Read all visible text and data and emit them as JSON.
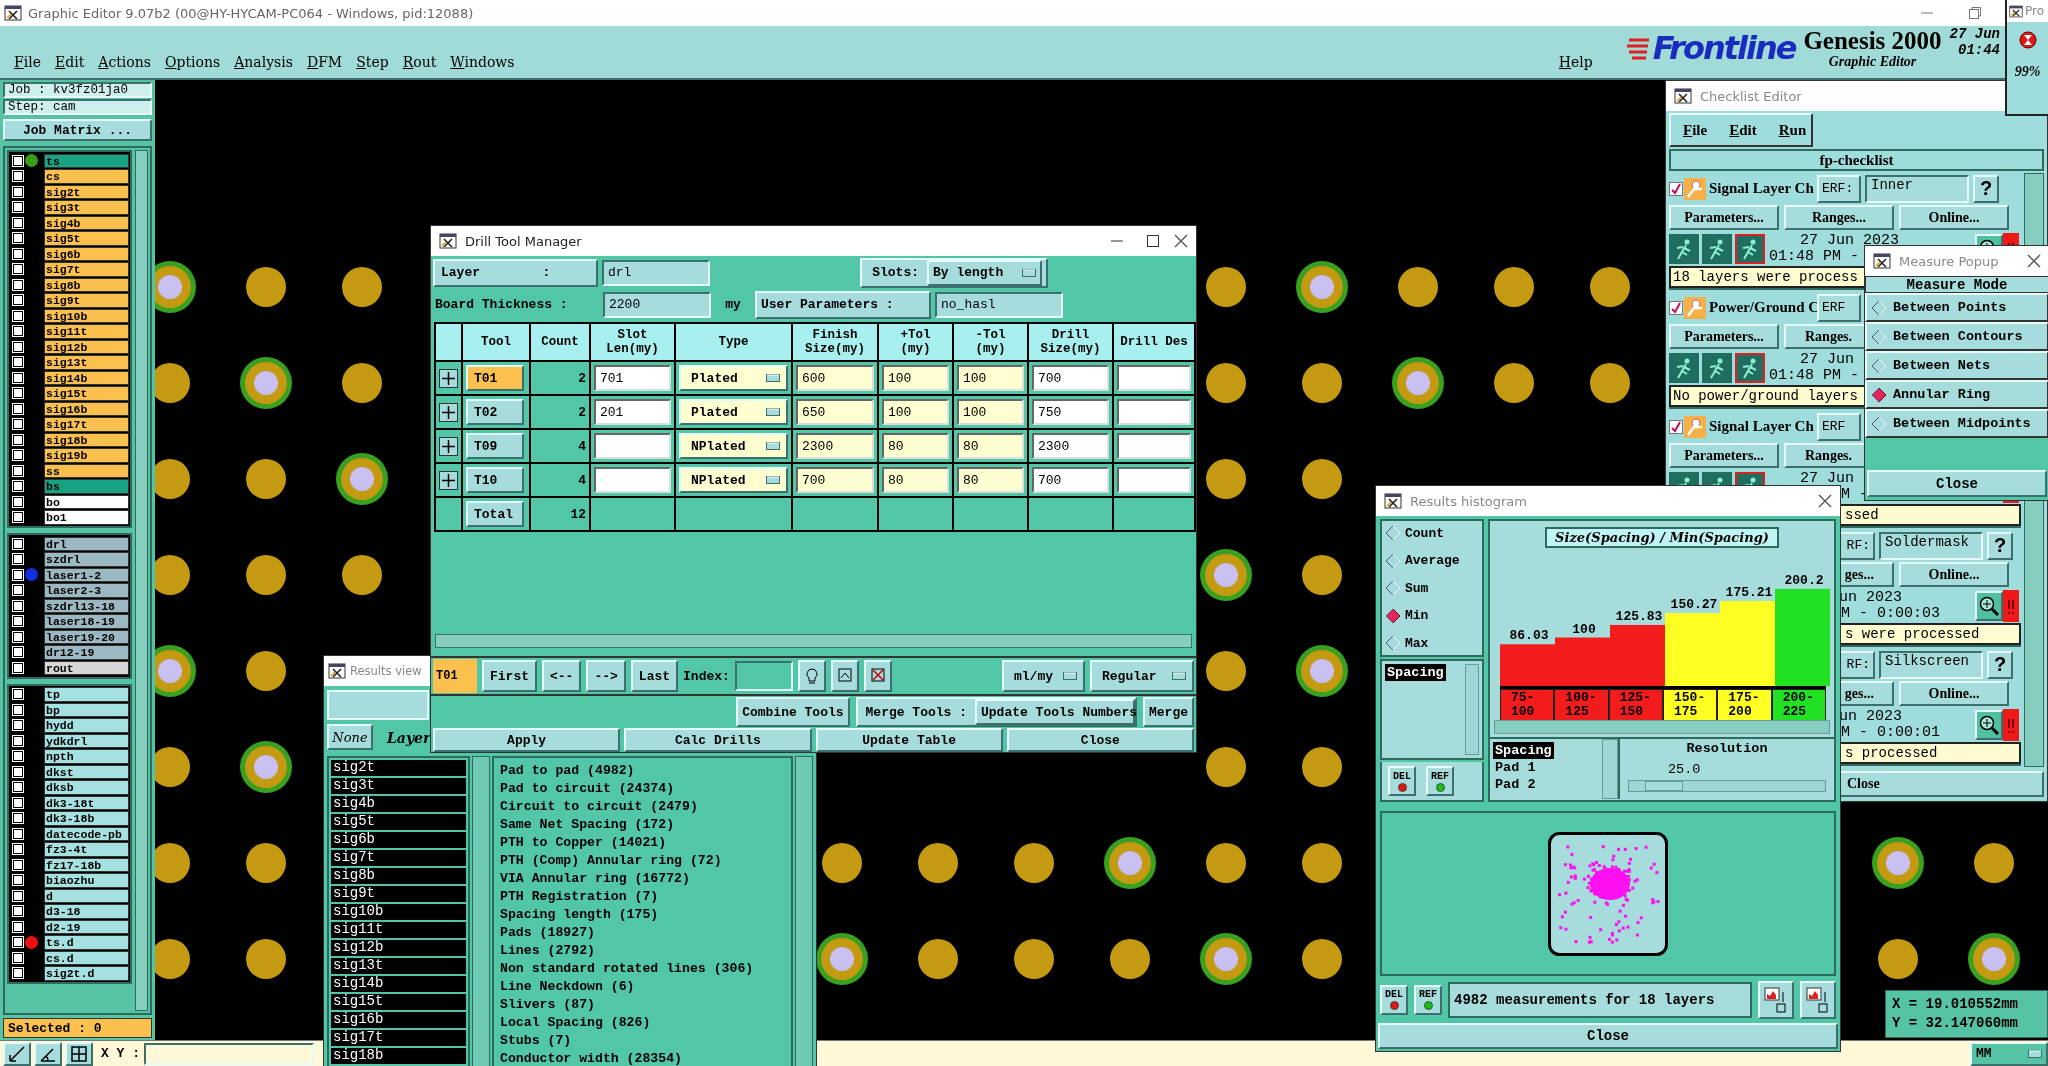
{
  "window": {
    "title": "Graphic Editor 9.07b2 (00@HY-HYCAM-PC064 - Windows, pid:12088)"
  },
  "menu": [
    {
      "label": "File"
    },
    {
      "label": "Edit"
    },
    {
      "label": "Actions"
    },
    {
      "label": "Options"
    },
    {
      "label": "Analysis"
    },
    {
      "label": "DFM"
    },
    {
      "label": "Step"
    },
    {
      "label": "Rout"
    },
    {
      "label": "Windows"
    }
  ],
  "help": "Help",
  "brand": {
    "logo": "Frontline",
    "product": "Genesis 2000",
    "subtitle": "Graphic Editor",
    "date": "27 Jun",
    "time": "01:44"
  },
  "progress_window": {
    "title": "Pro",
    "percent": "99%"
  },
  "job_panel": {
    "job": "Job : kv3fz01ja0",
    "step": "Step: cam",
    "matrix_button": "Job Matrix ...",
    "selected": "Selected : 0",
    "groups": [
      {
        "items": [
          {
            "name": "ts",
            "checked": false,
            "color": "#18a383",
            "marker": {
              "color": "#3a9a1a"
            }
          },
          {
            "name": "cs",
            "checked": false,
            "color": "#fbc04d"
          },
          {
            "name": "sig2t",
            "checked": false,
            "color": "#fbc04d"
          },
          {
            "name": "sig3t",
            "checked": false,
            "color": "#fbc04d"
          },
          {
            "name": "sig4b",
            "checked": false,
            "color": "#fbc04d"
          },
          {
            "name": "sig5t",
            "checked": false,
            "color": "#fbc04d"
          },
          {
            "name": "sig6b",
            "checked": false,
            "color": "#fbc04d"
          },
          {
            "name": "sig7t",
            "checked": false,
            "color": "#fbc04d"
          },
          {
            "name": "sig8b",
            "checked": false,
            "color": "#fbc04d"
          },
          {
            "name": "sig9t",
            "checked": false,
            "color": "#fbc04d"
          },
          {
            "name": "sig10b",
            "checked": false,
            "color": "#fbc04d"
          },
          {
            "name": "sig11t",
            "checked": false,
            "color": "#fbc04d"
          },
          {
            "name": "sig12b",
            "checked": false,
            "color": "#fbc04d"
          },
          {
            "name": "sig13t",
            "checked": false,
            "color": "#fbc04d"
          },
          {
            "name": "sig14b",
            "checked": false,
            "color": "#fbc04d"
          },
          {
            "name": "sig15t",
            "checked": false,
            "color": "#fbc04d"
          },
          {
            "name": "sig16b",
            "checked": false,
            "color": "#fbc04d"
          },
          {
            "name": "sig17t",
            "checked": false,
            "color": "#fbc04d"
          },
          {
            "name": "sig18b",
            "checked": false,
            "color": "#fbc04d"
          },
          {
            "name": "sig19b",
            "checked": false,
            "color": "#fbc04d"
          },
          {
            "name": "ss",
            "checked": false,
            "color": "#fbc04d"
          },
          {
            "name": "bs",
            "checked": false,
            "color": "#18a383"
          },
          {
            "name": "bo",
            "checked": false,
            "color": "#ffffff"
          },
          {
            "name": "bo1",
            "checked": false,
            "color": "#ffffff"
          }
        ]
      },
      {
        "items": [
          {
            "name": "drl",
            "checked": false,
            "color": "#9cb8c2"
          },
          {
            "name": "szdrl",
            "checked": false,
            "color": "#9cb8c2"
          },
          {
            "name": "laser1-2",
            "checked": false,
            "color": "#9cb8c2",
            "marker": {
              "color": "#1030e0"
            }
          },
          {
            "name": "laser2-3",
            "checked": false,
            "color": "#9cb8c2"
          },
          {
            "name": "szdrl13-18",
            "checked": false,
            "color": "#9cb8c2"
          },
          {
            "name": "laser18-19",
            "checked": false,
            "color": "#9cb8c2"
          },
          {
            "name": "laser19-20",
            "checked": false,
            "color": "#9cb8c2"
          },
          {
            "name": "dr12-19",
            "checked": false,
            "color": "#9cb8c2"
          },
          {
            "name": "rout",
            "checked": false,
            "color": "#d6d6d6"
          }
        ]
      },
      {
        "items": [
          {
            "name": "tp",
            "checked": false,
            "color": "#a5e1e1"
          },
          {
            "name": "bp",
            "checked": false,
            "color": "#a5e1e1"
          },
          {
            "name": "hydd",
            "checked": false,
            "color": "#a5e1e1"
          },
          {
            "name": "ydkdrl",
            "checked": false,
            "color": "#a5e1e1"
          },
          {
            "name": "npth",
            "checked": false,
            "color": "#a5e1e1"
          },
          {
            "name": "dkst",
            "checked": false,
            "color": "#a5e1e1"
          },
          {
            "name": "dksb",
            "checked": false,
            "color": "#a5e1e1"
          },
          {
            "name": "dk3-18t",
            "checked": false,
            "color": "#a5e1e1"
          },
          {
            "name": "dk3-18b",
            "checked": false,
            "color": "#a5e1e1"
          },
          {
            "name": "datecode-pb",
            "checked": false,
            "color": "#a5e1e1"
          },
          {
            "name": "fz3-4t",
            "checked": false,
            "color": "#a5e1e1"
          },
          {
            "name": "fz17-18b",
            "checked": false,
            "color": "#a5e1e1"
          },
          {
            "name": "biaozhu",
            "checked": false,
            "color": "#a5e1e1"
          },
          {
            "name": "d",
            "checked": false,
            "color": "#a5e1e1"
          },
          {
            "name": "d3-18",
            "checked": false,
            "color": "#a5e1e1"
          },
          {
            "name": "d2-19",
            "checked": false,
            "color": "#a5e1e1"
          },
          {
            "name": "ts.d",
            "checked": false,
            "color": "#a5e1e1",
            "marker": {
              "color": "#ee1111"
            }
          },
          {
            "name": "cs.d",
            "checked": false,
            "color": "#a5e1e1"
          },
          {
            "name": "sig2t.d",
            "checked": false,
            "color": "#a5e1e1"
          }
        ]
      }
    ]
  },
  "drill_manager": {
    "title": "Drill Tool Manager",
    "layer_label": "Layer        :",
    "layer": "drl",
    "slots_label": "Slots:",
    "slots": "By length",
    "thickness_label": "Board Thickness :",
    "thickness": "2200",
    "thickness_unit": "my",
    "user_params_button": "User Parameters :",
    "user_params": "no_hasl",
    "columns": [
      "Tool",
      "Count",
      "Slot Len(my)",
      "Type",
      "Finish Size(my)",
      "+Tol (my)",
      "-Tol (my)",
      "Drill Size(my)",
      "Drill Des"
    ],
    "rows": [
      {
        "tool": "T01",
        "selected": true,
        "count": "2",
        "slot_len": "701",
        "type": "Plated",
        "finish": "600",
        "plus_tol": "100",
        "minus_tol": "100",
        "drill_size": "700"
      },
      {
        "tool": "T02",
        "selected": false,
        "count": "2",
        "slot_len": "201",
        "type": "Plated",
        "finish": "650",
        "plus_tol": "100",
        "minus_tol": "100",
        "drill_size": "750"
      },
      {
        "tool": "T09",
        "selected": false,
        "count": "4",
        "type": "NPlated",
        "finish": "2300",
        "plus_tol": "80",
        "minus_tol": "80",
        "drill_size": "2300"
      },
      {
        "tool": "T10",
        "selected": false,
        "count": "4",
        "type": "NPlated",
        "finish": "700",
        "plus_tol": "80",
        "minus_tol": "80",
        "drill_size": "700"
      }
    ],
    "total_label": "Total",
    "total": "12",
    "current_tool": "T01",
    "nav_buttons": [
      "First",
      "<--",
      "-->",
      "Last"
    ],
    "index_label": "Index:",
    "units": "ml/my",
    "mode": "Regular",
    "combine_button": "Combine Tools",
    "merge_label": "Merge Tools :",
    "merge_mode": "Update Tools Numbers",
    "merge_button": "Merge",
    "actions": [
      "Apply",
      "Calc Drills",
      "Update Table",
      "Close"
    ]
  },
  "results_viewer": {
    "title": "Results view",
    "filter_button": "None",
    "column": "Layer",
    "layers": [
      {
        "name": "sig2t",
        "selected": true
      },
      {
        "name": "sig3t",
        "selected": true
      },
      {
        "name": "sig4b",
        "selected": true
      },
      {
        "name": "sig5t",
        "selected": true
      },
      {
        "name": "sig6b",
        "selected": true
      },
      {
        "name": "sig7t",
        "selected": true
      },
      {
        "name": "sig8b",
        "selected": true
      },
      {
        "name": "sig9t",
        "selected": true
      },
      {
        "name": "sig10b",
        "selected": true
      },
      {
        "name": "sig11t",
        "selected": true
      },
      {
        "name": "sig12b",
        "selected": true
      },
      {
        "name": "sig13t",
        "selected": true
      },
      {
        "name": "sig14b",
        "selected": true
      },
      {
        "name": "sig15t",
        "selected": true
      },
      {
        "name": "sig16b",
        "selected": true
      },
      {
        "name": "sig17t",
        "selected": true
      },
      {
        "name": "sig18b",
        "selected": true
      }
    ],
    "results": [
      "Pad to pad (4982)",
      "Pad to circuit (24374)",
      "Circuit to circuit (2479)",
      "Same Net Spacing (172)",
      "PTH to Copper (14021)",
      "PTH (Comp) Annular ring (72)",
      "VIA Annular ring (16772)",
      "PTH Registration (7)",
      "Spacing length (175)",
      "Pads (18927)",
      "Lines (2792)",
      "Non standard rotated lines (306)",
      "Line Neckdown (6)",
      "Slivers (87)",
      "Local Spacing (826)",
      "Stubs (7)",
      "Conductor width (28354)"
    ]
  },
  "checklist": {
    "title": "Checklist Editor",
    "menu": [
      "File",
      "Edit",
      "Run"
    ],
    "name": "fp-checklist",
    "close": "Close",
    "entries": [
      {
        "kind": "top",
        "checked": true,
        "title": "Signal Layer Ch",
        "erf_label": "ERF:",
        "erf": "Inner",
        "help": "?",
        "buttons": [
          "Parameters...",
          "Ranges...",
          "Online..."
        ],
        "date": "27 Jun 2023",
        "time": "01:48 PM -",
        "status": "18 layers were process"
      },
      {
        "kind": "middle",
        "checked": true,
        "title": "Power/Ground C",
        "erf_label": "ERF",
        "buttons": [
          "Parameters...",
          "Ranges."
        ],
        "date": "27 Jun",
        "time": "01:48 PM -",
        "status": "No power/ground layers"
      },
      {
        "kind": "lower",
        "checked": true,
        "title": "Signal Layer Ch",
        "erf_label": "ERF",
        "buttons": [
          "Parameters...",
          "Ranges."
        ],
        "date": "27 Jun",
        "time": "M -",
        "status": "ssed"
      },
      {
        "kind": "bottom",
        "erf_label": "RF:",
        "erf": "Soldermask",
        "help": "?",
        "buttons": [
          "ges...",
          "Online..."
        ],
        "date": "un 2023",
        "time": "M - 0:00:03",
        "status": "s were processed"
      },
      {
        "kind": "bottom",
        "erf_label": "RF:",
        "erf": "Silkscreen",
        "help": "?",
        "buttons": [
          "ges...",
          "Online..."
        ],
        "date": "un 2023",
        "time": "M - 0:00:01",
        "status": "s processed"
      }
    ]
  },
  "measure_popup": {
    "title": "Measure Popup",
    "heading": "Measure Mode",
    "close": "Close",
    "options": [
      {
        "label": "Between Points",
        "selected": false
      },
      {
        "label": "Between Contours",
        "selected": false
      },
      {
        "label": "Between Nets",
        "selected": false
      },
      {
        "label": "Annular Ring",
        "selected": true
      },
      {
        "label": "Between Midpoints",
        "selected": false
      }
    ]
  },
  "histogram": {
    "title": "Results histogram",
    "stats": [
      {
        "label": "Count",
        "selected": false
      },
      {
        "label": "Average",
        "selected": false
      },
      {
        "label": "Sum",
        "selected": false
      },
      {
        "label": "Min",
        "selected": true
      },
      {
        "label": "Max",
        "selected": false
      }
    ],
    "fields": [
      {
        "label": "Spacing",
        "selected": true
      }
    ],
    "field_buttons": [
      "DEL",
      "REF"
    ],
    "chart_data": {
      "type": "bar",
      "title": "Size(Spacing) / Min(Spacing)",
      "categories": [
        "75-100",
        "100-125",
        "125-150",
        "150-175",
        "175-200",
        "200-225"
      ],
      "values": [
        86.03,
        100,
        125.83,
        150.27,
        175.21,
        200.2
      ],
      "data_labels": true
    },
    "bins": [
      {
        "color": "#f21c1c"
      },
      {
        "color": "#f21c1c"
      },
      {
        "color": "#f21c1c"
      },
      {
        "color": "#ffff22"
      },
      {
        "color": "#ffff22"
      },
      {
        "color": "#22e022"
      }
    ],
    "attributes": [
      {
        "label": "Spacing",
        "selected": true
      },
      {
        "label": "Pad 1",
        "selected": false
      },
      {
        "label": "Pad 2",
        "selected": false
      }
    ],
    "resolution_label": "Resolution",
    "resolution": "25.0",
    "resolution_slider": {
      "level": 0.08
    },
    "map_buttons": [
      "DEL",
      "REF"
    ],
    "summary": "4982 measurements for 18 layers",
    "close": "Close"
  },
  "status_bar": {
    "xy_label": "X Y :",
    "units": "MM"
  },
  "coordinates": [
    "X = 19.010552mm",
    "Y = 32.147060mm"
  ]
}
